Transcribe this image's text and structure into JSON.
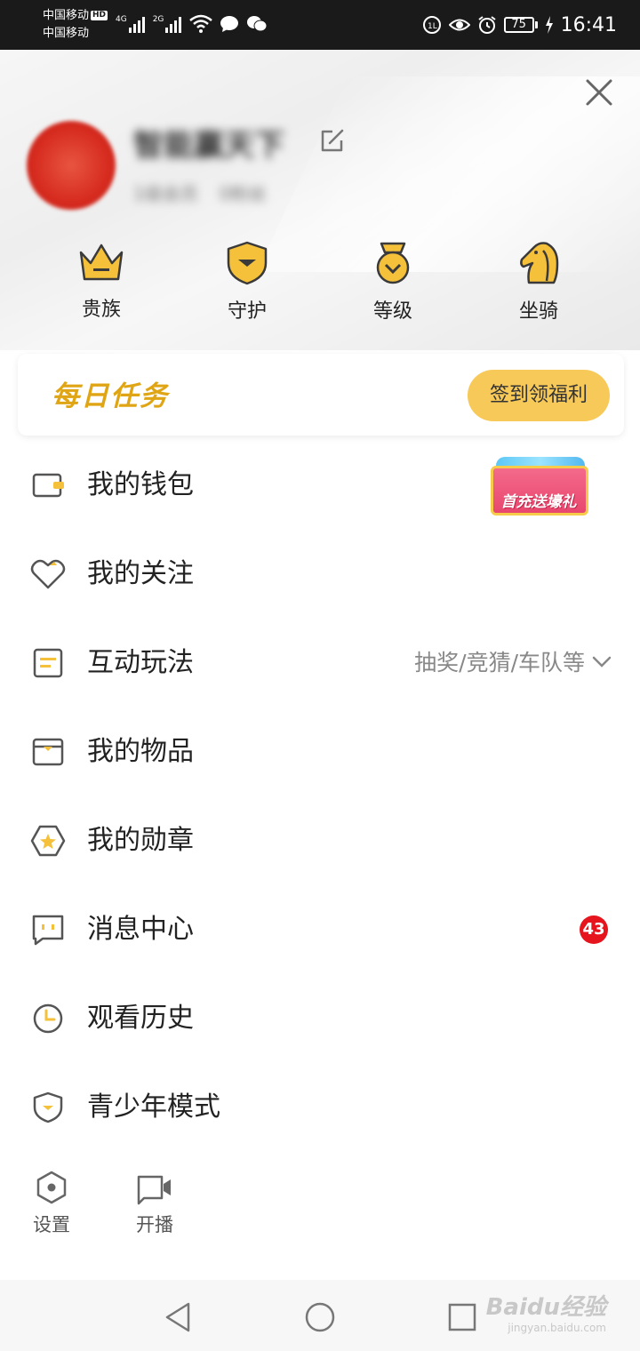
{
  "status_bar": {
    "carrier1": "中国移动",
    "carrier1_badge": "HD",
    "carrier2": "中国移动",
    "net1": "4G",
    "net2": "2G",
    "battery": "75",
    "time": "16:41"
  },
  "profile": {
    "username": "智能赢天下",
    "sub_info": [
      "1级会员",
      "0粉丝"
    ]
  },
  "privileges": [
    {
      "label": "贵族",
      "icon": "crown-icon"
    },
    {
      "label": "守护",
      "icon": "guard-shield-icon"
    },
    {
      "label": "等级",
      "icon": "level-medal-icon"
    },
    {
      "label": "坐骑",
      "icon": "horse-mount-icon"
    }
  ],
  "daily_task": {
    "title": "每日任务",
    "button": "签到领福利"
  },
  "menu": {
    "wallet": {
      "label": "我的钱包",
      "promo": "首充送壕礼"
    },
    "follow": {
      "label": "我的关注"
    },
    "interactive": {
      "label": "互动玩法",
      "extra": "抽奖/竞猜/车队等"
    },
    "items": {
      "label": "我的物品"
    },
    "medals": {
      "label": "我的勋章"
    },
    "messages": {
      "label": "消息中心",
      "badge": "43"
    },
    "history": {
      "label": "观看历史"
    },
    "teen": {
      "label": "青少年模式"
    }
  },
  "bottom_actions": [
    {
      "label": "设置",
      "icon": "settings-hexagon-icon"
    },
    {
      "label": "开播",
      "icon": "camera-live-icon"
    }
  ],
  "watermark": {
    "line1": "Baidu经验",
    "line2": "jingyan.baidu.com"
  },
  "colors": {
    "accent": "#e0a514",
    "button": "#f7c959",
    "badge": "#e6141c",
    "icon_gray": "#555555"
  }
}
